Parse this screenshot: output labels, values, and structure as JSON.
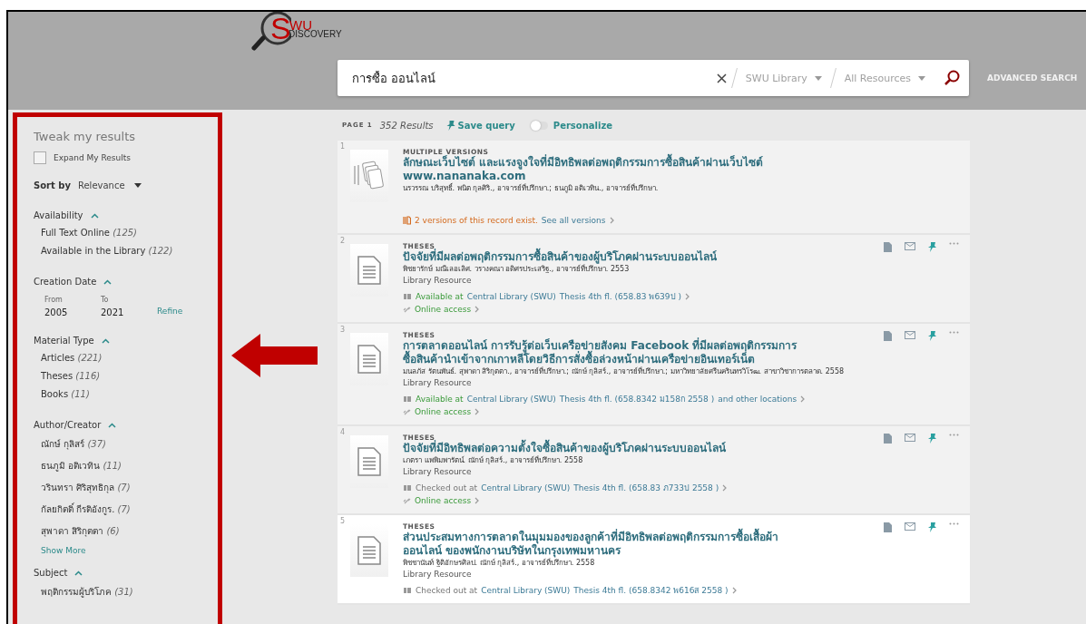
{
  "header": {
    "logo": {
      "letter": "S",
      "rest": "WU",
      "sub": "DISCOVERY"
    },
    "search": {
      "value": "การซื้อ ออนไลน์",
      "scope": "SWU Library",
      "resource": "All Resources"
    },
    "advanced": "ADVANCED SEARCH"
  },
  "sidebar": {
    "title": "Tweak my results",
    "expand": {
      "label": "Expand My Results",
      "checked": false
    },
    "sort": {
      "label": "Sort by",
      "value": "Relevance"
    },
    "facets": [
      {
        "kind": "list",
        "title": "Availability",
        "expanded": true,
        "items": [
          {
            "label": "Full Text Online",
            "count": "(125)"
          },
          {
            "label": "Available in the Library",
            "count": "(122)"
          }
        ]
      },
      {
        "kind": "date",
        "title": "Creation Date",
        "expanded": true,
        "from_label": "From",
        "to_label": "To",
        "from": "2005",
        "to": "2021",
        "action": "Refine"
      },
      {
        "kind": "list",
        "title": "Material Type",
        "expanded": true,
        "items": [
          {
            "label": "Articles",
            "count": "(221)"
          },
          {
            "label": "Theses",
            "count": "(116)"
          },
          {
            "label": "Books",
            "count": "(11)"
          }
        ]
      },
      {
        "kind": "list",
        "title": "Author/Creator",
        "expanded": true,
        "items": [
          {
            "label": "ณักษ์ กุลิสร์",
            "count": "(37)"
          },
          {
            "label": "ธนภูมิ อติเวทิน",
            "count": "(11)"
          },
          {
            "label": "วรินทรา ศิริสุทธิกุล",
            "count": "(7)"
          },
          {
            "label": "กัลยกิตติ์ กีรติอังกูร.",
            "count": "(7)"
          },
          {
            "label": "สุพาดา สิริกุตตา",
            "count": "(6)"
          }
        ],
        "more": "Show More"
      },
      {
        "kind": "list",
        "title": "Subject",
        "expanded": true,
        "items": [
          {
            "label": "พฤติกรรมผู้บริโภค",
            "count": "(31)"
          }
        ]
      }
    ]
  },
  "results": {
    "page": "PAGE 1",
    "count": "352 Results",
    "save": "Save query",
    "personalize": {
      "label": "Personalize",
      "on": false
    },
    "records": [
      {
        "number": "1",
        "kind": "versions",
        "hovered": false,
        "type": "MULTIPLE VERSIONS",
        "title": "ลักษณะเว็บไซต์ และแรงจูงใจที่มีอิทธิพลต่อพฤติกรรมการซื้อสินค้าผ่านเว็บไซต์ www.nananaka.com",
        "authors": "นรวรรณ บริสุทธิ์. พนิต กุลศิริ., อาจารย์ที่ปรึกษา.; ธนภูมิ อติเวทิน., อาจารย์ที่ปรึกษา.",
        "versions": "2 versions of this record exist.",
        "see_all": "See all versions"
      },
      {
        "number": "2",
        "kind": "thesis",
        "hovered": false,
        "type": "THESES",
        "title": "ปัจจัยที่มีผลต่อพฤติกรรมการซื้อสินค้าของผู้บริโภคผ่านระบบออนไลน์",
        "authors": "พิชยารักษ์ มณีเลอเลิศ. วรางคณา อดิศรประเสริฐ., อาจารย์ที่ปรึกษา. 2553",
        "resource": "Library Resource",
        "availability": {
          "available": true,
          "status": "Available at",
          "location": "Central Library (SWU)",
          "shelf": "Thesis 4th fl. (658.83 พ639ป )"
        },
        "online": "Online access"
      },
      {
        "number": "3",
        "kind": "thesis",
        "hovered": false,
        "type": "THESES",
        "title": "การตลาดออนไลน์ การรับรู้ต่อเว็บเครือข่ายสังคม Facebook ที่มีผลต่อพฤติกรรมการซื้อสินค้านำเข้าจากเกาหลีโดยวิธีการสั่งซื้อล่วงหน้าผ่านเครือข่ายอินเทอร์เน็ต",
        "authors": "มนลภัส รัตนพันธ์. สุพาดา สิริกุตตา., อาจารย์ที่ปรึกษา.; ณักษ์ กุลิสร์., อาจารย์ที่ปรึกษา.; มหาวิทยาลัยศรีนครินทรวิโรฒ. สาขาวิชาการตลาด. 2558",
        "resource": "Library Resource",
        "availability": {
          "available": true,
          "status": "Available at",
          "location": "Central Library (SWU)",
          "shelf": "Thesis 4th fl. (658.8342 ม158ก 2558 )",
          "more": "and other locations"
        },
        "online": "Online access"
      },
      {
        "number": "4",
        "kind": "thesis",
        "hovered": false,
        "type": "THESES",
        "title": "ปัจจัยที่มีอิทธิพลต่อความตั้งใจซื้อสินค้าของผู้บริโภคผ่านระบบออนไลน์",
        "authors": "เภตรา แพพิมพารัตน์. ณักษ์ กุลิสร์., อาจารย์ที่ปรึกษา. 2558",
        "resource": "Library Resource",
        "availability": {
          "available": false,
          "status": "Checked out at",
          "location": "Central Library (SWU)",
          "shelf": "Thesis 4th fl. (658.83 ภ733ป 2558 )"
        },
        "online": "Online access"
      },
      {
        "number": "5",
        "kind": "thesis",
        "hovered": true,
        "type": "THESES",
        "title": "ส่วนประสมทางการตลาดในมุมมองของลูกค้าที่มีอิทธิพลต่อพฤติกรรมการซื้อเสื้อผ้าออนไลน์ ของพนักงานบริษัทในกรุงเทพมหานคร",
        "authors": "พิชชานันท์ ฐิติอักษรศิลป. ณักษ์ กุลิสร์., อาจารย์ที่ปรึกษา. 2558",
        "resource": "Library Resource",
        "availability": {
          "available": false,
          "status": "Checked out at",
          "location": "Central Library (SWU)",
          "shelf": "Thesis 4th fl. (658.8342 พ616ส 2558 )"
        }
      }
    ]
  }
}
